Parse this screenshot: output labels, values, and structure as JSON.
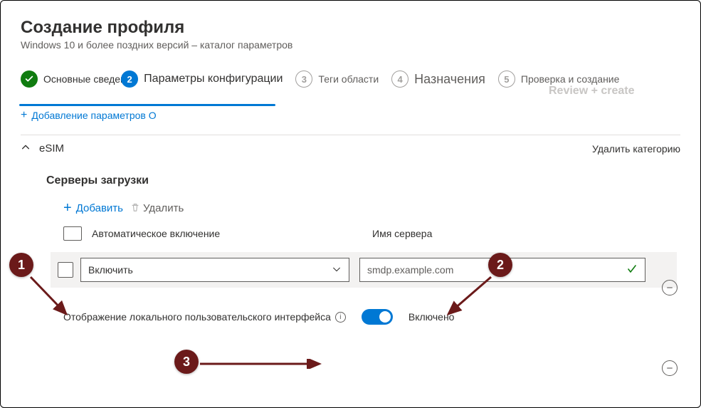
{
  "header": {
    "title": "Создание профиля",
    "subtitle": "Windows 10 и более поздних версий – каталог параметров"
  },
  "wizard": {
    "step1": {
      "label": "Основные сведения"
    },
    "step2": {
      "num": "2",
      "label": "Параметры конфигурации"
    },
    "step3": {
      "num": "3",
      "label": "Теги области"
    },
    "step4": {
      "num": "4",
      "label": "Назначения"
    },
    "step5": {
      "num": "5",
      "label": "Проверка и создание"
    }
  },
  "faded_text": "Review + create",
  "actions": {
    "add_settings": "Добавление параметров О"
  },
  "category": {
    "name": "eSIM",
    "remove": "Удалить категорию"
  },
  "download_servers": {
    "heading": "Серверы загрузки",
    "add": "Добавить",
    "delete": "Удалить",
    "col_auto": "Автоматическое включение",
    "col_server": "Имя сервера",
    "row": {
      "auto_value": "Включить",
      "server_value": "smdp.example.com"
    }
  },
  "local_ui": {
    "label": "Отображение локального пользовательского интерфейса",
    "status": "Включено"
  },
  "annotations": {
    "n1": "1",
    "n2": "2",
    "n3": "3"
  }
}
